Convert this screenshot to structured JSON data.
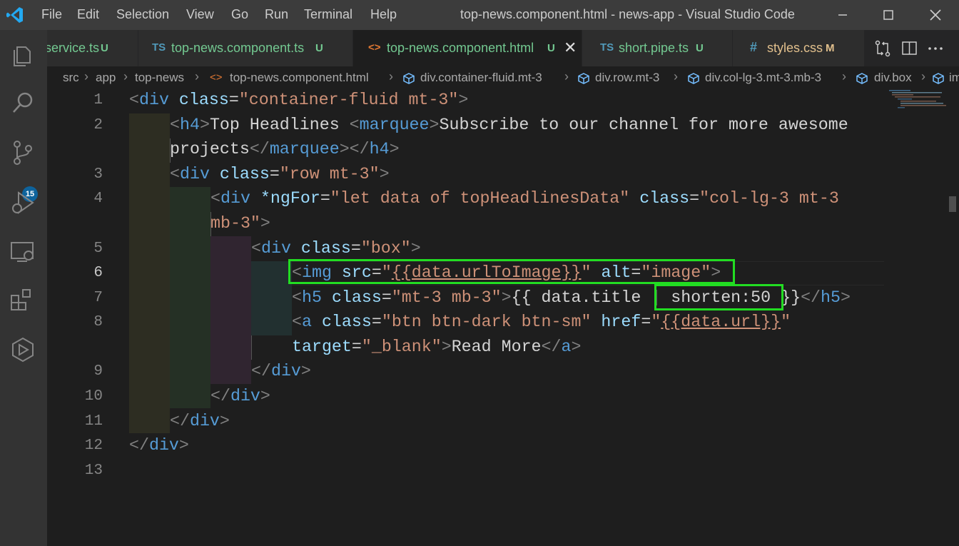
{
  "menu": [
    "File",
    "Edit",
    "Selection",
    "View",
    "Go",
    "Run",
    "Terminal",
    "Help"
  ],
  "window_title": "top-news.component.html - news-app - Visual Studio Code",
  "activity": {
    "scm_badge": "15"
  },
  "tabs": [
    {
      "icon": "",
      "label": "service.ts",
      "status": "U"
    },
    {
      "icon": "TS",
      "label": "top-news.component.ts",
      "status": "U"
    },
    {
      "icon": "<>",
      "label": "top-news.component.html",
      "status": "U",
      "close": "✕"
    },
    {
      "icon": "TS",
      "label": "short.pipe.ts",
      "status": "U"
    },
    {
      "icon": "#",
      "label": "styles.css",
      "status": "M"
    }
  ],
  "breadcrumb": [
    "src",
    "app",
    "top-news",
    "top-news.component.html",
    "div.container-fluid.mt-3",
    "div.row.mt-3",
    "div.col-lg-3.mt-3.mb-3",
    "div.box",
    "im"
  ],
  "line_numbers": [
    "1",
    "2",
    "3",
    "4",
    "5",
    "6",
    "7",
    "8",
    "9",
    "10",
    "11",
    "12",
    "13"
  ],
  "code": {
    "l1": {
      "lt": "<",
      "tag": "div",
      "sp": " ",
      "attr": "class",
      "eq": "=",
      "val": "\"container-fluid mt-3\"",
      "gt": ">"
    },
    "l2a": {
      "lt": "<",
      "tag": "h4",
      "gt": ">",
      "text": "Top Headlines ",
      "lt2": "<",
      "tag2": "marquee",
      "gt2": ">",
      "text2": "Subscribe to our channel for more awesome"
    },
    "l2b": {
      "text": "projects",
      "lt": "</",
      "tag": "marquee",
      "gt": ">",
      "lt2": "</",
      "tag2": "h4",
      "gt2": ">"
    },
    "l3": {
      "lt": "<",
      "tag": "div",
      "attr": "class",
      "eq": "=",
      "val": "\"row mt-3\"",
      "gt": ">"
    },
    "l4a": {
      "lt": "<",
      "tag": "div",
      "attr": "*ngFor",
      "eq": "=",
      "val": "\"let data of topHeadlinesData\"",
      "attr2": "class",
      "eq2": "=",
      "val2": "\"col-lg-3 mt-3"
    },
    "l4b": {
      "val": "mb-3\"",
      "gt": ">"
    },
    "l5": {
      "lt": "<",
      "tag": "div",
      "attr": "class",
      "eq": "=",
      "val": "\"box\"",
      "gt": ">"
    },
    "l6": {
      "lt": "<",
      "tag": "img",
      "attr": "src",
      "eq": "=",
      "q1": "\"",
      "interp": "{{data.urlToImage}}",
      "q2": "\"",
      "attr2": "alt",
      "eq2": "=",
      "val2": "\"image\"",
      "gt": ">"
    },
    "l7": {
      "lt": "<",
      "tag": "h5",
      "attr": "class",
      "eq": "=",
      "val": "\"mt-3 mb-3\"",
      "gt": ">",
      "text": "{{ data.title ",
      "pipe": "| shorten:50",
      "text2": " }}",
      "lt2": "</",
      "tag2": "h5",
      "gt2": ">"
    },
    "l8a": {
      "lt": "<",
      "tag": "a",
      "attr": "class",
      "eq": "=",
      "val": "\"btn btn-dark btn-sm\"",
      "attr2": "href",
      "eq2": "=",
      "q1": "\"",
      "interp": "{{data.url}}",
      "q2": "\""
    },
    "l8b": {
      "attr": "target",
      "eq": "=",
      "val": "\"_blank\"",
      "gt": ">",
      "text": "Read More",
      "lt2": "</",
      "tag2": "a",
      "gt2": ">"
    },
    "l9": {
      "lt": "</",
      "tag": "div",
      "gt": ">"
    },
    "l10": {
      "lt": "</",
      "tag": "div",
      "gt": ">"
    },
    "l11": {
      "lt": "</",
      "tag": "div",
      "gt": ">"
    },
    "l12": {
      "lt": "</",
      "tag": "div",
      "gt": ">"
    }
  },
  "colors": {
    "tag": "#569cd6",
    "attr": "#9cdcfe",
    "string": "#ce9178",
    "punct": "#808080",
    "text": "#d4d4d4",
    "highlight": "#22dd22",
    "git_untracked": "#73c991",
    "git_modified": "#e2c08d"
  }
}
